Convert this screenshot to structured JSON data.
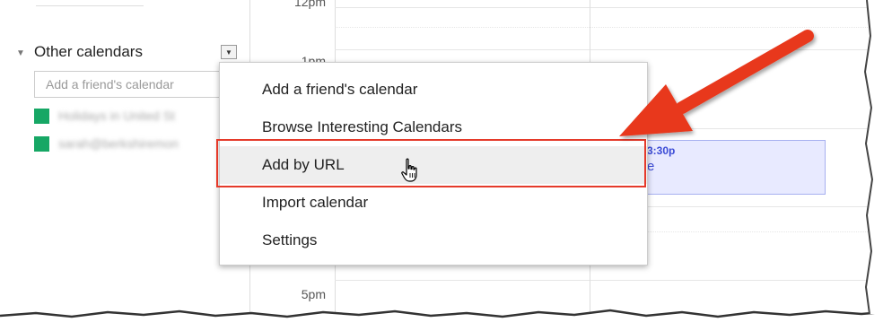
{
  "sidebar": {
    "section_title": "Other calendars",
    "friend_input_placeholder": "Add a friend's calendar",
    "calendars": [
      {
        "name": "Holidays in United St",
        "color": "#16a765"
      },
      {
        "name": "sarah@berkshiremon",
        "color": "#16a765"
      }
    ]
  },
  "grid": {
    "time_labels": [
      "12pm",
      "1pm",
      "5pm"
    ]
  },
  "event": {
    "time": "3:30p",
    "title": "e"
  },
  "menu": {
    "items": [
      {
        "label": "Add a friend's calendar"
      },
      {
        "label": "Browse Interesting Calendars"
      },
      {
        "label": "Add by URL"
      },
      {
        "label": "Import calendar"
      },
      {
        "label": "Settings"
      }
    ]
  },
  "colors": {
    "calendar_green": "#16a765",
    "annotation_red": "#e53a2a",
    "event_blue": "#3b4bd6"
  }
}
